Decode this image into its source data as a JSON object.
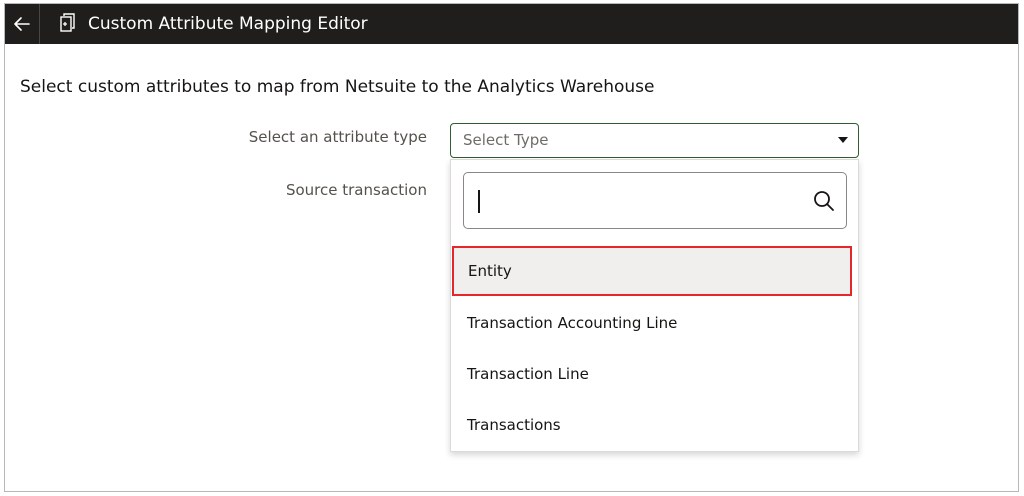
{
  "titlebar": {
    "back_icon": "arrow-left-icon",
    "doc_icon": "document-edit-icon",
    "title": "Custom Attribute Mapping Editor",
    "background": "#1f1e1c"
  },
  "main": {
    "instruction": "Select custom attributes to map from Netsuite to the Analytics Warehouse"
  },
  "form": {
    "attribute_type_label": "Select an attribute type",
    "attribute_type_placeholder": "Select Type",
    "source_transaction_label": "Source transaction"
  },
  "dropdown": {
    "search_value": "",
    "search_icon": "search-icon",
    "highlight_color": "#e5262b",
    "options": [
      {
        "label": "Entity",
        "highlighted": true
      },
      {
        "label": "Transaction Accounting Line",
        "highlighted": false
      },
      {
        "label": "Transaction Line",
        "highlighted": false
      },
      {
        "label": "Transactions",
        "highlighted": false
      }
    ]
  }
}
